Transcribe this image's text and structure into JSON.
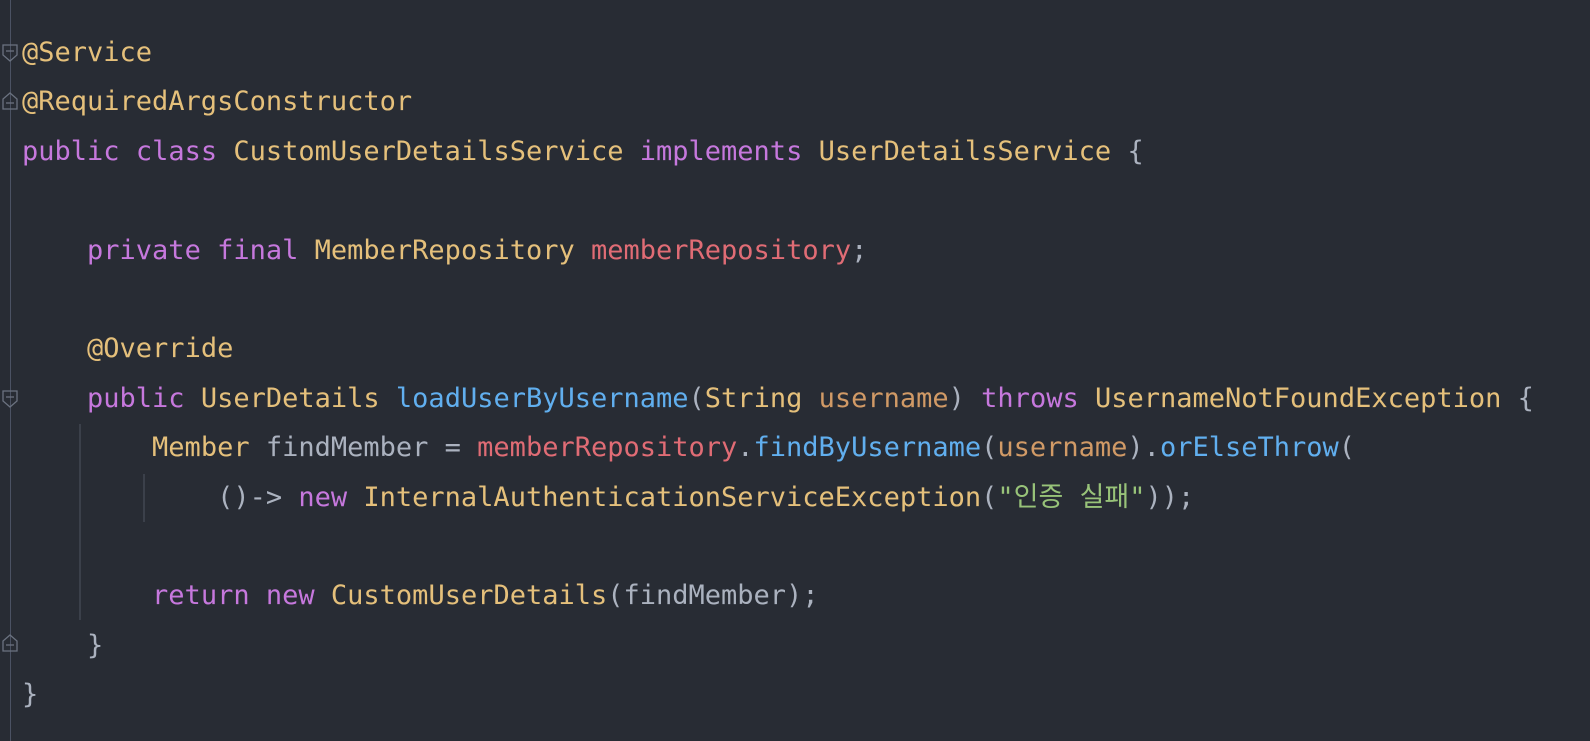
{
  "editor": {
    "colors": {
      "background": "#282c34",
      "keyword": "#c678dd",
      "type": "#e5c07b",
      "field": "#e06c75",
      "method": "#61afef",
      "parameter": "#d19a66",
      "string": "#98c379",
      "plain": "#abb2bf"
    },
    "lines": [
      {
        "tokens": [
          {
            "t": "@Service",
            "k": "annotation"
          }
        ]
      },
      {
        "tokens": [
          {
            "t": "@RequiredArgsConstructor",
            "k": "annotation"
          }
        ]
      },
      {
        "tokens": [
          {
            "t": "public",
            "k": "keyword"
          },
          {
            "t": " ",
            "k": "plain"
          },
          {
            "t": "class",
            "k": "keyword"
          },
          {
            "t": " ",
            "k": "plain"
          },
          {
            "t": "CustomUserDetailsService",
            "k": "type"
          },
          {
            "t": " ",
            "k": "plain"
          },
          {
            "t": "implements",
            "k": "keyword"
          },
          {
            "t": " ",
            "k": "plain"
          },
          {
            "t": "UserDetailsService",
            "k": "type"
          },
          {
            "t": " {",
            "k": "plain"
          }
        ]
      },
      {
        "tokens": []
      },
      {
        "tokens": [
          {
            "t": "    ",
            "k": "plain"
          },
          {
            "t": "private",
            "k": "keyword"
          },
          {
            "t": " ",
            "k": "plain"
          },
          {
            "t": "final",
            "k": "keyword"
          },
          {
            "t": " ",
            "k": "plain"
          },
          {
            "t": "MemberRepository",
            "k": "type"
          },
          {
            "t": " ",
            "k": "plain"
          },
          {
            "t": "memberRepository",
            "k": "field"
          },
          {
            "t": ";",
            "k": "plain"
          }
        ]
      },
      {
        "tokens": []
      },
      {
        "tokens": [
          {
            "t": "    ",
            "k": "plain"
          },
          {
            "t": "@Override",
            "k": "annotation"
          }
        ]
      },
      {
        "tokens": [
          {
            "t": "    ",
            "k": "plain"
          },
          {
            "t": "public",
            "k": "keyword"
          },
          {
            "t": " ",
            "k": "plain"
          },
          {
            "t": "UserDetails",
            "k": "type"
          },
          {
            "t": " ",
            "k": "plain"
          },
          {
            "t": "loadUserByUsername",
            "k": "method"
          },
          {
            "t": "(",
            "k": "plain"
          },
          {
            "t": "String",
            "k": "type"
          },
          {
            "t": " ",
            "k": "plain"
          },
          {
            "t": "username",
            "k": "param"
          },
          {
            "t": ") ",
            "k": "plain"
          },
          {
            "t": "throws",
            "k": "keyword"
          },
          {
            "t": " ",
            "k": "plain"
          },
          {
            "t": "UsernameNotFoundException",
            "k": "type"
          },
          {
            "t": " {",
            "k": "plain"
          }
        ]
      },
      {
        "tokens": [
          {
            "t": "        ",
            "k": "plain"
          },
          {
            "t": "Member",
            "k": "type"
          },
          {
            "t": " findMember = ",
            "k": "plain"
          },
          {
            "t": "memberRepository",
            "k": "field"
          },
          {
            "t": ".",
            "k": "plain"
          },
          {
            "t": "findByUsername",
            "k": "method"
          },
          {
            "t": "(",
            "k": "plain"
          },
          {
            "t": "username",
            "k": "param"
          },
          {
            "t": ").",
            "k": "plain"
          },
          {
            "t": "orElseThrow",
            "k": "method"
          },
          {
            "t": "(",
            "k": "plain"
          }
        ]
      },
      {
        "tokens": [
          {
            "t": "            ()-> ",
            "k": "plain"
          },
          {
            "t": "new",
            "k": "keyword"
          },
          {
            "t": " ",
            "k": "plain"
          },
          {
            "t": "InternalAuthenticationServiceException",
            "k": "type"
          },
          {
            "t": "(",
            "k": "plain"
          },
          {
            "t": "\"인증 실패\"",
            "k": "string"
          },
          {
            "t": "));",
            "k": "plain"
          }
        ]
      },
      {
        "tokens": []
      },
      {
        "tokens": [
          {
            "t": "        ",
            "k": "plain"
          },
          {
            "t": "return",
            "k": "keyword"
          },
          {
            "t": " ",
            "k": "plain"
          },
          {
            "t": "new",
            "k": "keyword"
          },
          {
            "t": " ",
            "k": "plain"
          },
          {
            "t": "CustomUserDetails",
            "k": "type"
          },
          {
            "t": "(findMember);",
            "k": "plain"
          }
        ]
      },
      {
        "tokens": [
          {
            "t": "    }",
            "k": "plain"
          }
        ]
      },
      {
        "tokens": [
          {
            "t": "}",
            "k": "plain"
          }
        ]
      }
    ]
  }
}
